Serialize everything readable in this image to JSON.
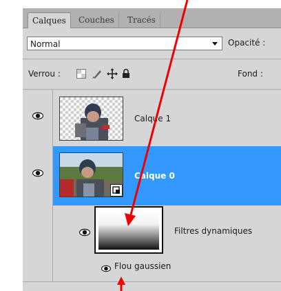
{
  "tabs": [
    {
      "label": "Calques",
      "active": true
    },
    {
      "label": "Couches",
      "active": false
    },
    {
      "label": "Tracés",
      "active": false
    }
  ],
  "blend_mode": {
    "value": "Normal"
  },
  "opacity": {
    "label": "Opacité :"
  },
  "lock": {
    "label": "Verrou :"
  },
  "fill": {
    "label": "Fond :"
  },
  "layers": [
    {
      "name": "Calque 1",
      "selected": false,
      "visible": true
    },
    {
      "name": "Calque 0",
      "selected": true,
      "visible": true
    }
  ],
  "smart_filters": {
    "label": "Filtres dynamiques",
    "visible": true
  },
  "filter_effects": [
    {
      "label": "Flou gaussien",
      "visible": true
    }
  ],
  "colors": {
    "selection": "#3399ff",
    "annotation_arrow": "#ee0000",
    "panel_bg": "#d6d6d6"
  }
}
